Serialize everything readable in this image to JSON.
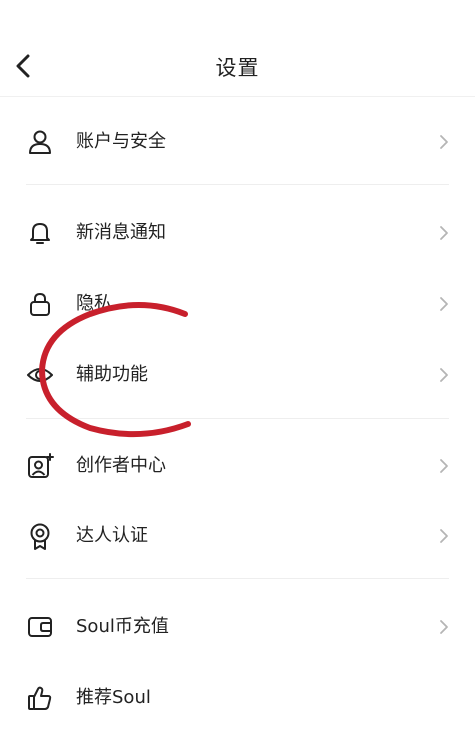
{
  "header": {
    "title": "设置"
  },
  "menu": {
    "items": [
      {
        "label": "账户与安全",
        "icon": "user-icon"
      },
      {
        "label": "新消息通知",
        "icon": "bell-icon"
      },
      {
        "label": "隐私",
        "icon": "lock-icon"
      },
      {
        "label": "辅助功能",
        "icon": "eye-icon"
      },
      {
        "label": "创作者中心",
        "icon": "creator-icon"
      },
      {
        "label": "达人认证",
        "icon": "badge-icon"
      },
      {
        "label": "Soul币充值",
        "icon": "wallet-icon"
      },
      {
        "label": "推荐Soul",
        "icon": "thumbs-up-icon"
      }
    ]
  },
  "colors": {
    "annotation": "#c8202c",
    "text": "#222222",
    "chevron": "#b5b5b5",
    "divider": "#eeeeee"
  }
}
